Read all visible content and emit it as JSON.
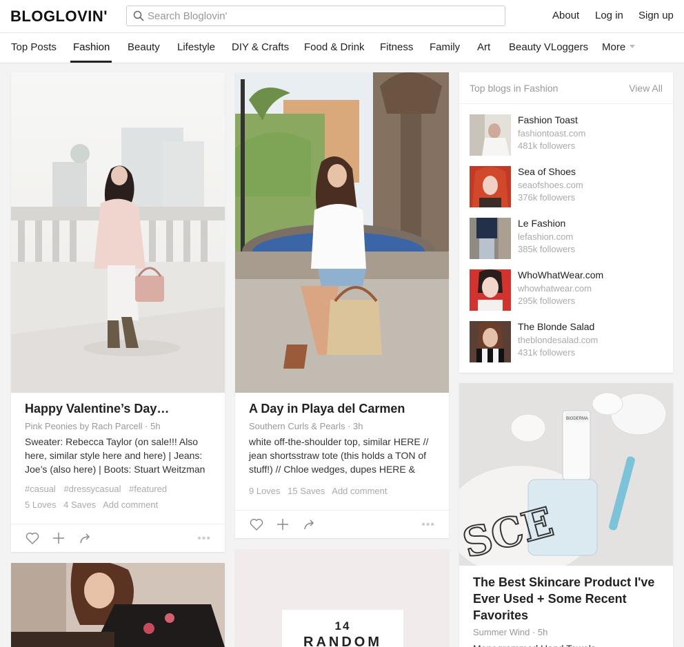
{
  "header": {
    "logo": "BLOGLOVIN'",
    "search_placeholder": "Search Bloglovin'",
    "links": [
      "About",
      "Log in",
      "Sign up"
    ]
  },
  "nav": {
    "tabs": [
      "Top Posts",
      "Fashion",
      "Beauty",
      "Lifestyle",
      "DIY & Crafts",
      "Food & Drink",
      "Fitness",
      "Family",
      "Art",
      "Beauty VLoggers",
      "More"
    ],
    "active": "Fashion"
  },
  "posts": [
    {
      "title": "Happy Valentine’s Day…",
      "meta": "Pink Peonies by Rach Parcell · 5h",
      "excerpt": "Sweater: Rebecca Taylor (on sale!!! Also here, similar style here and here) | Jeans: Joe’s (also here) | Boots: Stuart Weitzman",
      "tags": [
        "#casual",
        "#dressycasual",
        "#featured"
      ],
      "loves": "5 Loves",
      "saves": "4 Saves",
      "comment": "Add comment"
    },
    {
      "title": "A Day in Playa del Carmen",
      "meta": "Southern Curls & Pearls · 3h",
      "excerpt": "white off-the-shoulder top, similar HERE // jean shortsstraw tote (this holds a TON of stuff!) // Chloe wedges, dupes HERE &",
      "loves": "9 Loves",
      "saves": "15 Saves",
      "comment": "Add comment"
    },
    {
      "title": "The Best Skincare Product I've Ever Used + Some Recent Favorites",
      "meta": "Summer Wind · 5h",
      "excerpt": "Monogrammed Hand Towels"
    }
  ],
  "poster_text": {
    "line1": "14",
    "line2": "RANDOM"
  },
  "product_text": {
    "monogram": "SCE",
    "brand": "BIODERMA"
  },
  "top_blogs": {
    "title": "Top blogs in Fashion",
    "view_all": "View All",
    "items": [
      {
        "name": "Fashion Toast",
        "url": "fashiontoast.com",
        "followers": "481k followers"
      },
      {
        "name": "Sea of Shoes",
        "url": "seaofshoes.com",
        "followers": "376k followers"
      },
      {
        "name": "Le Fashion",
        "url": "lefashion.com",
        "followers": "385k followers"
      },
      {
        "name": "WhoWhatWear.com",
        "url": "whowhatwear.com",
        "followers": "295k followers"
      },
      {
        "name": "The Blonde Salad",
        "url": "theblondesalad.com",
        "followers": "431k followers"
      }
    ]
  }
}
